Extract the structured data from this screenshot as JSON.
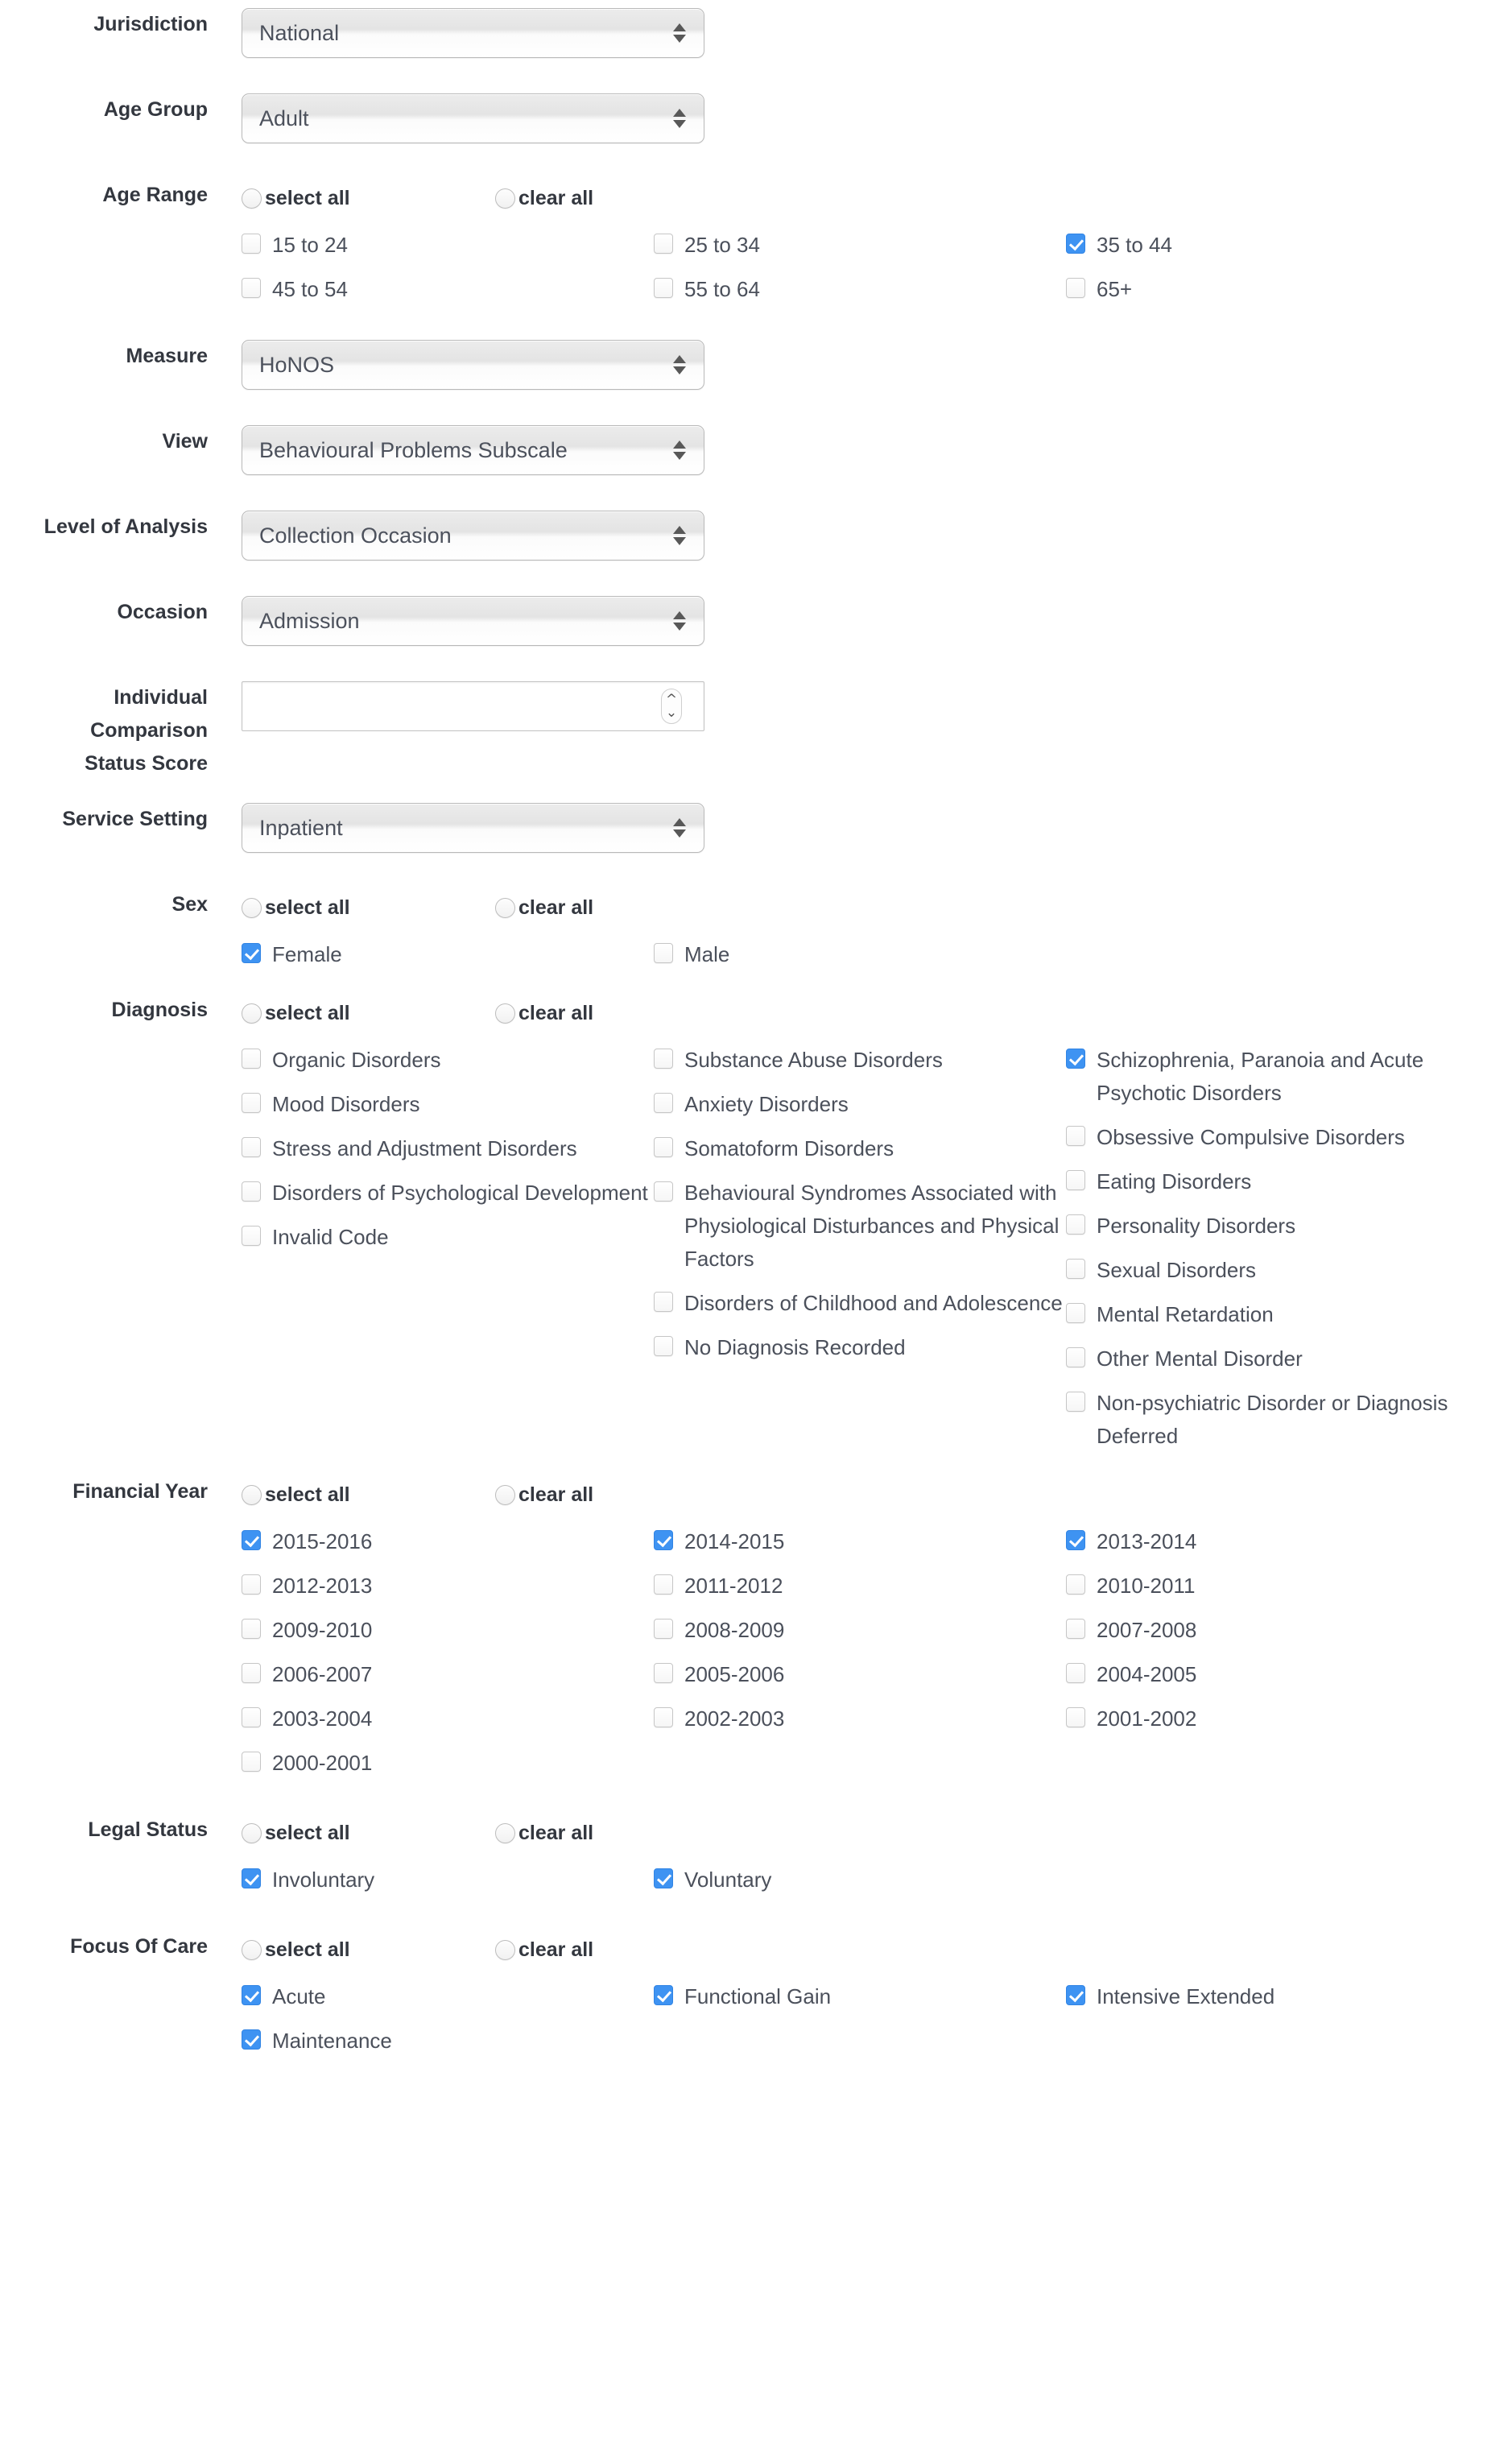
{
  "colors": {
    "accent": "#3e93f2",
    "label": "#33373f",
    "text": "#4b505b"
  },
  "common": {
    "select_all": "select all",
    "clear_all": "clear all"
  },
  "fields": {
    "jurisdiction": {
      "label": "Jurisdiction",
      "value": "National"
    },
    "age_group": {
      "label": "Age Group",
      "value": "Adult"
    },
    "age_range": {
      "label": "Age Range"
    },
    "measure": {
      "label": "Measure",
      "value": "HoNOS"
    },
    "view": {
      "label": "View",
      "value": "Behavioural Problems Subscale"
    },
    "level_of_analysis": {
      "label": "Level of Analysis",
      "value": "Collection Occasion"
    },
    "occasion": {
      "label": "Occasion",
      "value": "Admission"
    },
    "individual_comparison_status_score": {
      "label_lines": [
        "Individual",
        "Comparison",
        "Status Score"
      ],
      "value": "",
      "placeholder": ""
    },
    "service_setting": {
      "label": "Service Setting",
      "value": "Inpatient"
    },
    "sex": {
      "label": "Sex"
    },
    "diagnosis": {
      "label": "Diagnosis"
    },
    "financial_year": {
      "label": "Financial Year"
    },
    "legal_status": {
      "label": "Legal Status"
    },
    "focus_of_care": {
      "label": "Focus Of Care"
    }
  },
  "age_range_options": [
    {
      "label": "15 to 24",
      "checked": false
    },
    {
      "label": "25 to 34",
      "checked": false
    },
    {
      "label": "35 to 44",
      "checked": true
    },
    {
      "label": "45 to 54",
      "checked": false
    },
    {
      "label": "55 to 64",
      "checked": false
    },
    {
      "label": "65+",
      "checked": false
    }
  ],
  "sex_options": [
    {
      "label": "Female",
      "checked": true
    },
    {
      "label": "Male",
      "checked": false
    }
  ],
  "diagnosis_columns": [
    [
      {
        "label": "Organic Disorders",
        "checked": false
      },
      {
        "label": "Mood Disorders",
        "checked": false
      },
      {
        "label": "Stress and Adjustment Disorders",
        "checked": false
      },
      {
        "label": "Disorders of Psychological Development",
        "checked": false
      },
      {
        "label": "Invalid Code",
        "checked": false
      }
    ],
    [
      {
        "label": "Substance Abuse Disorders",
        "checked": false
      },
      {
        "label": "Anxiety Disorders",
        "checked": false
      },
      {
        "label": "Somatoform Disorders",
        "checked": false
      },
      {
        "label": "Behavioural Syndromes Associated with Physiological Disturbances and Physical Factors",
        "checked": false
      },
      {
        "label": "Disorders of Childhood and Adolescence",
        "checked": false
      },
      {
        "label": "No Diagnosis Recorded",
        "checked": false
      }
    ],
    [
      {
        "label": "Schizophrenia, Paranoia and Acute Psychotic Disorders",
        "checked": true
      },
      {
        "label": "Obsessive Compulsive Disorders",
        "checked": false
      },
      {
        "label": "Eating Disorders",
        "checked": false
      },
      {
        "label": "Personality Disorders",
        "checked": false
      },
      {
        "label": "Sexual Disorders",
        "checked": false
      },
      {
        "label": "Mental Retardation",
        "checked": false
      },
      {
        "label": "Other Mental Disorder",
        "checked": false
      },
      {
        "label": "Non-psychiatric Disorder or Diagnosis Deferred",
        "checked": false
      }
    ]
  ],
  "financial_year_options": [
    {
      "label": "2015-2016",
      "checked": true
    },
    {
      "label": "2014-2015",
      "checked": true
    },
    {
      "label": "2013-2014",
      "checked": true
    },
    {
      "label": "2012-2013",
      "checked": false
    },
    {
      "label": "2011-2012",
      "checked": false
    },
    {
      "label": "2010-2011",
      "checked": false
    },
    {
      "label": "2009-2010",
      "checked": false
    },
    {
      "label": "2008-2009",
      "checked": false
    },
    {
      "label": "2007-2008",
      "checked": false
    },
    {
      "label": "2006-2007",
      "checked": false
    },
    {
      "label": "2005-2006",
      "checked": false
    },
    {
      "label": "2004-2005",
      "checked": false
    },
    {
      "label": "2003-2004",
      "checked": false
    },
    {
      "label": "2002-2003",
      "checked": false
    },
    {
      "label": "2001-2002",
      "checked": false
    },
    {
      "label": "2000-2001",
      "checked": false
    }
  ],
  "legal_status_options": [
    {
      "label": "Involuntary",
      "checked": true
    },
    {
      "label": "Voluntary",
      "checked": true
    }
  ],
  "focus_of_care_options": [
    {
      "label": "Acute",
      "checked": true
    },
    {
      "label": "Functional Gain",
      "checked": true
    },
    {
      "label": "Intensive Extended",
      "checked": true
    },
    {
      "label": "Maintenance",
      "checked": true
    }
  ]
}
